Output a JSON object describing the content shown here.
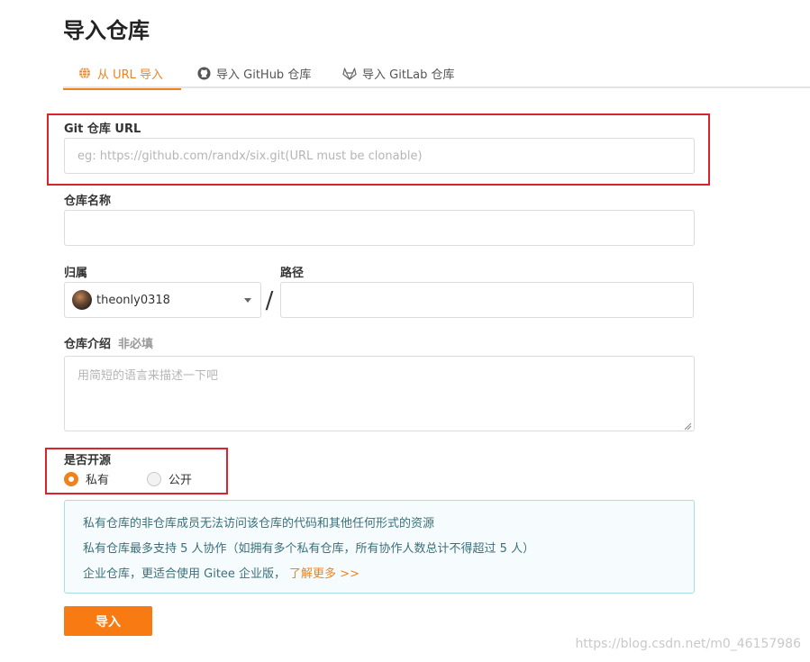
{
  "page": {
    "title": "导入仓库"
  },
  "tabs": [
    {
      "label": "从 URL 导入",
      "icon": "globe-icon",
      "active": true
    },
    {
      "label": "导入 GitHub 仓库",
      "icon": "github-icon",
      "active": false
    },
    {
      "label": "导入 GitLab 仓库",
      "icon": "gitlab-icon",
      "active": false
    }
  ],
  "form": {
    "git_url": {
      "label": "Git 仓库 URL",
      "value": "",
      "placeholder": "eg: https://github.com/randx/six.git(URL must be clonable)"
    },
    "repo_name": {
      "label": "仓库名称",
      "value": ""
    },
    "owner": {
      "label": "归属",
      "value": "theonly0318"
    },
    "path": {
      "label": "路径",
      "value": ""
    },
    "separator": "/",
    "description": {
      "label": "仓库介绍",
      "optional_label": "非必填",
      "placeholder": "用简短的语言来描述一下吧",
      "value": ""
    },
    "visibility": {
      "label": "是否开源",
      "options": [
        {
          "label": "私有",
          "checked": true
        },
        {
          "label": "公开",
          "checked": false
        }
      ]
    }
  },
  "notice": {
    "lines": [
      "私有仓库的非仓库成员无法访问该仓库的代码和其他任何形式的资源",
      "私有仓库最多支持 5 人协作（如拥有多个私有仓库，所有协作人数总计不得超过 5 人）",
      "企业仓库，更适合使用 Gitee 企业版，"
    ],
    "link_label": "了解更多 >>"
  },
  "submit_label": "导入",
  "watermark": "https://blog.csdn.net/m0_46157986",
  "colors": {
    "accent": "#f0821e",
    "highlight_border": "#d9232e",
    "notice_bg": "#f6fcfd",
    "notice_border": "#a8dde6"
  }
}
